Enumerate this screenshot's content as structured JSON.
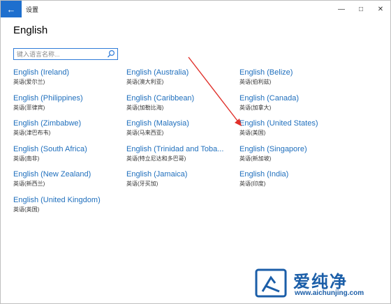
{
  "window": {
    "title": "设置"
  },
  "page": {
    "title": "English"
  },
  "search": {
    "placeholder": "键入语言名称..."
  },
  "languages": [
    {
      "name": "English (Ireland)",
      "native": "英语(爱尔兰)"
    },
    {
      "name": "English (Australia)",
      "native": "英语(澳大利亚)"
    },
    {
      "name": "English (Belize)",
      "native": "英语(伯利兹)"
    },
    {
      "name": "English (Philippines)",
      "native": "英语(菲律宾)"
    },
    {
      "name": "English (Caribbean)",
      "native": "英语(加勒比海)"
    },
    {
      "name": "English (Canada)",
      "native": "英语(加拿大)"
    },
    {
      "name": "English (Zimbabwe)",
      "native": "英语(津巴布韦)"
    },
    {
      "name": "English (Malaysia)",
      "native": "英语(马来西亚)"
    },
    {
      "name": "English (United States)",
      "native": "英语(美国)"
    },
    {
      "name": "English (South Africa)",
      "native": "英语(南非)"
    },
    {
      "name": "English (Trinidad and Toba...",
      "native": "英语(特立尼达和多巴哥)"
    },
    {
      "name": "English (Singapore)",
      "native": "英语(新加坡)"
    },
    {
      "name": "English (New Zealand)",
      "native": "英语(新西兰)"
    },
    {
      "name": "English (Jamaica)",
      "native": "英语(牙买加)"
    },
    {
      "name": "English (India)",
      "native": "英语(印度)"
    },
    {
      "name": "English (United Kingdom)",
      "native": "英语(英国)"
    }
  ],
  "watermark": {
    "brand": "爱纯净",
    "url": "www.aichunjing.com"
  },
  "colors": {
    "accent": "#1e6fce",
    "link": "#1f6fbd",
    "annotation": "#e0302a",
    "brand": "#1b5ea8"
  }
}
